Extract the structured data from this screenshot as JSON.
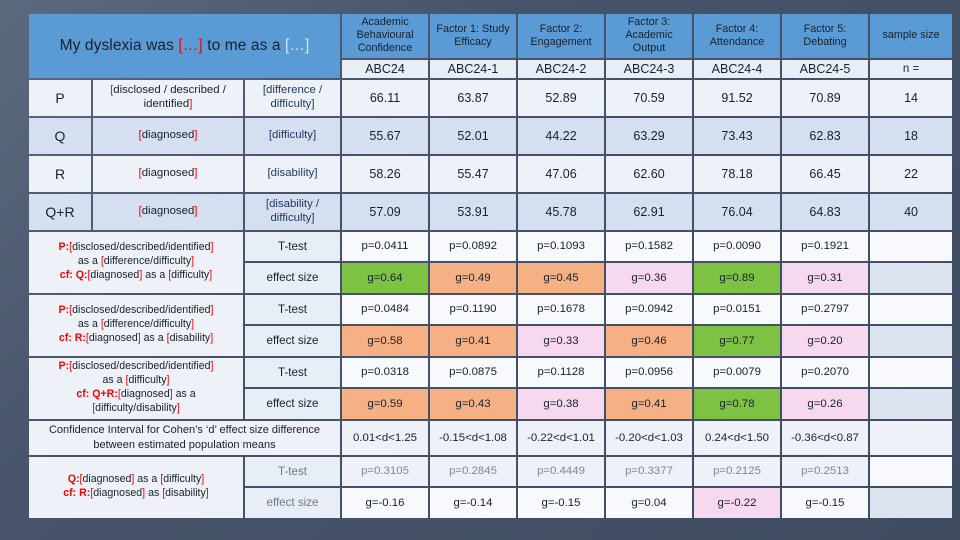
{
  "title": {
    "prefix": "My dyslexia was ",
    "red": "[…]",
    "middle": " to me as a ",
    "pale": "[…]"
  },
  "columns": [
    {
      "label": "Academic Behavioural Confidence",
      "code": "ABC24"
    },
    {
      "label": "Factor 1: Study Efficacy",
      "code": "ABC24-1"
    },
    {
      "label": "Factor 2: Engagement",
      "code": "ABC24-2"
    },
    {
      "label": "Factor 3: Academic Output",
      "code": "ABC24-3"
    },
    {
      "label": "Factor 4: Attendance",
      "code": "ABC24-4"
    },
    {
      "label": "Factor 5: Debating",
      "code": "ABC24-5"
    },
    {
      "label": "sample size",
      "code": "n ="
    }
  ],
  "groups": [
    {
      "key": "P",
      "desc1": "[disclosed / described / identified]",
      "desc2": "[difference / difficulty]",
      "values": [
        "66.11",
        "63.87",
        "52.89",
        "70.59",
        "91.52",
        "70.89"
      ],
      "n": "14"
    },
    {
      "key": "Q",
      "desc1": "[diagnosed]",
      "desc2": "[difficulty]",
      "values": [
        "55.67",
        "52.01",
        "44.22",
        "63.29",
        "73.43",
        "62.83"
      ],
      "n": "18"
    },
    {
      "key": "R",
      "desc1": "[diagnosed]",
      "desc2": "[disability]",
      "values": [
        "58.26",
        "55.47",
        "47.06",
        "62.60",
        "78.18",
        "66.45"
      ],
      "n": "22"
    },
    {
      "key": "Q+R",
      "desc1": "[diagnosed]",
      "desc2": "[disability / difficulty]",
      "values": [
        "57.09",
        "53.91",
        "45.78",
        "62.91",
        "76.04",
        "64.83"
      ],
      "n": "40"
    }
  ],
  "comparisons": [
    {
      "label_lines": [
        {
          "bold": "P:",
          "rest": "[disclosed/described/identified]"
        },
        {
          "bold": "",
          "rest": "as a [difference/difficulty]"
        },
        {
          "bold": "cf: Q:",
          "rest": "[diagnosed] as a [difficulty]"
        }
      ],
      "ttest_label": "T-test",
      "effect_label": "effect size",
      "p_values": [
        "p=0.0411",
        "p=0.0892",
        "p=0.1093",
        "p=0.1582",
        "p=0.0090",
        "p=0.1921"
      ],
      "g_values": [
        "g=0.64",
        "g=0.49",
        "g=0.45",
        "g=0.36",
        "g=0.89",
        "g=0.31"
      ],
      "g_colors": [
        "bg-green",
        "bg-orange",
        "bg-orange",
        "bg-pink",
        "bg-green",
        "bg-pink"
      ],
      "dim": false
    },
    {
      "label_lines": [
        {
          "bold": "P:",
          "rest": "[disclosed/described/identified]"
        },
        {
          "bold": "",
          "rest": "as a [difference/difficulty]"
        },
        {
          "bold": "cf: R:",
          "rest": "[diagnosed] as a [disability]"
        }
      ],
      "ttest_label": "T-test",
      "effect_label": "effect size",
      "p_values": [
        "p=0.0484",
        "p=0.1190",
        "p=0.1678",
        "p=0.0942",
        "p=0.0151",
        "p=0.2797"
      ],
      "g_values": [
        "g=0.58",
        "g=0.41",
        "g=0.33",
        "g=0.46",
        "g=0.77",
        "g=0.20"
      ],
      "g_colors": [
        "bg-orange",
        "bg-orange",
        "bg-pink",
        "bg-orange",
        "bg-green",
        "bg-pink"
      ],
      "dim": false
    },
    {
      "label_lines": [
        {
          "bold": "P:",
          "rest": "[disclosed/described/identified]"
        },
        {
          "bold": "",
          "rest": "as a [difficulty]"
        },
        {
          "bold": "cf: Q+R:",
          "rest": "[diagnosed] as a"
        },
        {
          "bold": "",
          "rest": "[difficulty/disability]"
        }
      ],
      "ttest_label": "T-test",
      "effect_label": "effect size",
      "p_values": [
        "p=0.0318",
        "p=0.0875",
        "p=0.1128",
        "p=0.0956",
        "p=0.0079",
        "p=0.2070"
      ],
      "g_values": [
        "g=0.59",
        "g=0.43",
        "g=0.38",
        "g=0.41",
        "g=0.78",
        "g=0.26"
      ],
      "g_colors": [
        "bg-orange",
        "bg-orange",
        "bg-pink",
        "bg-orange",
        "bg-green",
        "bg-pink"
      ],
      "dim": false
    }
  ],
  "confidence_interval": {
    "label": "Confidence Interval for Cohen’s ‘d’ effect size difference between estimated population means",
    "values": [
      "0.01<d<1.25",
      "-0.15<d<1.08",
      "-0.22<d<1.01",
      "-0.20<d<1.03",
      "0.24<d<1.50",
      "-0.36<d<0.87"
    ],
    "colors": [
      "bg-orange",
      "bg-orange",
      "bg-pink",
      "bg-orange",
      "bg-green",
      "bg-pink"
    ]
  },
  "last_comparison": {
    "label_lines": [
      {
        "bold": "Q:",
        "rest": "[diagnosed] as a [difficulty]"
      },
      {
        "bold": "cf: R:",
        "rest": "[diagnosed] as [disability]"
      }
    ],
    "ttest_label": "T-test",
    "effect_label": "effect size",
    "p_values": [
      "p=0.3105",
      "p=0.2845",
      "p=0.4449",
      "p=0.3377",
      "p=0.2125",
      "p=0.2513"
    ],
    "g_values": [
      "g=-0.16",
      "g=-0.14",
      "g=-0.15",
      "g=0.04",
      "g=-0.22",
      "g=-0.15"
    ],
    "g_colors": [
      "bg-plain",
      "bg-plain",
      "bg-plain",
      "bg-plain",
      "bg-pink",
      "bg-plain"
    ],
    "dim": true
  },
  "palette": {
    "header_blue": "#5b9bd5",
    "green": "#7dc242",
    "orange": "#f5b183",
    "pink": "#f6d9ef",
    "red_text": "#ff0000",
    "blue_text": "#1f3864",
    "background": "#46536a"
  }
}
